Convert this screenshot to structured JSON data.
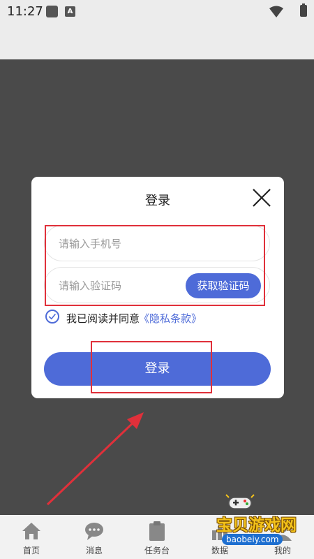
{
  "statusbar": {
    "time": "11:27",
    "a_icon_letter": "A"
  },
  "dialog": {
    "title": "登录",
    "phone_placeholder": "请输入手机号",
    "code_placeholder": "请输入验证码",
    "code_button": "获取验证码",
    "agree_text": "我已阅读并同意",
    "privacy_link": "《隐私条款》",
    "login_button": "登录"
  },
  "nav": {
    "items": [
      {
        "label": "首页",
        "icon": "home-icon"
      },
      {
        "label": "消息",
        "icon": "chat-icon"
      },
      {
        "label": "任务台",
        "icon": "clipboard-icon"
      },
      {
        "label": "数据",
        "icon": "chart-icon"
      },
      {
        "label": "我的",
        "icon": "user-icon"
      }
    ]
  },
  "watermark": {
    "text": "宝贝游戏网",
    "url": "baobeiy.com"
  },
  "colors": {
    "accent": "#4e6bd8",
    "annotation": "#e0303a",
    "overlay": "#4a4a4a"
  }
}
